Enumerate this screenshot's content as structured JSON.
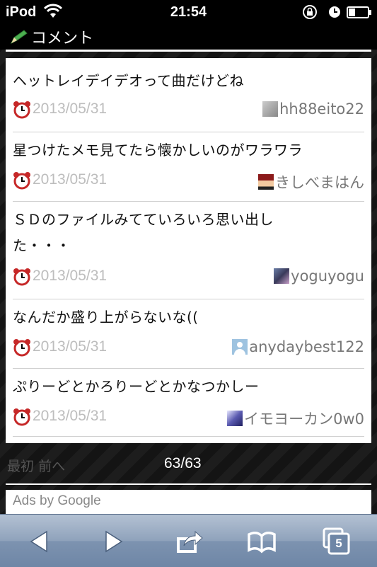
{
  "status_bar": {
    "carrier": "iPod",
    "time": "21:54"
  },
  "header": {
    "title": "コメント"
  },
  "comments": [
    {
      "text_lines": [
        "ヘットレイデイデオって曲だけどね"
      ],
      "date": "2013/05/31",
      "user": "hh88eito22"
    },
    {
      "text_lines": [
        "星つけたメモ見てたら懐かしいのがワラワラ"
      ],
      "date": "2013/05/31",
      "user": "きしべまはん"
    },
    {
      "text_lines": [
        "ＳＤのファイルみてていろいろ思い出し",
        "た・・・"
      ],
      "date": "2013/05/31",
      "user": "yoguyogu"
    },
    {
      "text_lines": [
        "なんだか盛り上がらないな(("
      ],
      "date": "2013/05/31",
      "user": "anydaybest122"
    },
    {
      "text_lines": [
        "ぷりーどとかろりーどとかなつかしー"
      ],
      "date": "2013/05/31",
      "user": "イモヨーカン0w0"
    }
  ],
  "pager": {
    "first": "最初",
    "prev": "前へ",
    "count": "63/63"
  },
  "ads": {
    "label": "Ads by Google"
  },
  "toolbar": {
    "tab_count": "5"
  },
  "colors": {
    "toolbar": "#8fa2bb",
    "date_text": "#bdbdbd",
    "user_text": "#777777"
  }
}
